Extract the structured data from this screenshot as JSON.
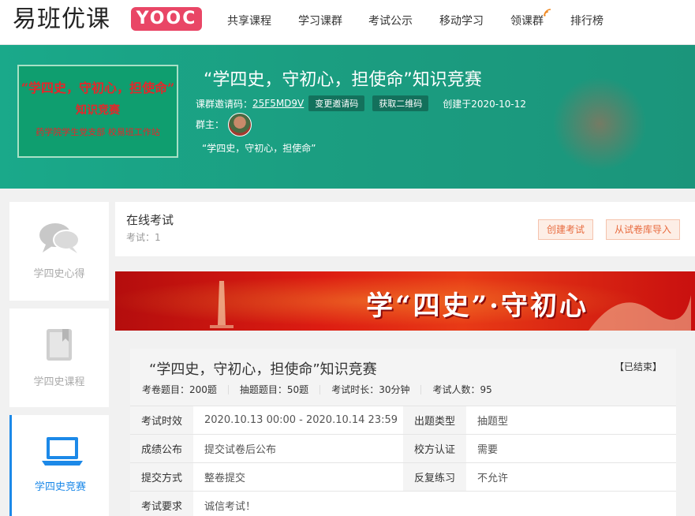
{
  "nav": {
    "logo_cn": "易班优课",
    "logo_en": "YOOC",
    "items": [
      "共享课程",
      "学习课群",
      "考试公示",
      "移动学习",
      "领课群",
      "排行榜"
    ]
  },
  "hero": {
    "cover": {
      "line1": "“学四史，守初心，担使命”",
      "line2": "知识竞赛",
      "line3": "药学院学生党支部  校易班工作站"
    },
    "title": "“学四史，守初心，担使命”知识竞赛",
    "invite_label": "课群邀请码：",
    "invite_code": "25F5MD9V",
    "change_code_btn": "变更邀请码",
    "qrcode_btn": "获取二维码",
    "created": "创建于2020-10-12",
    "owner_label": "群主：",
    "description": "“学四史，守初心，担使命”"
  },
  "sidebar": {
    "items": [
      {
        "label": "学四史心得",
        "icon": "chat-bubbles-icon"
      },
      {
        "label": "学四史课程",
        "icon": "book-icon"
      },
      {
        "label": "学四史竞赛",
        "icon": "laptop-icon"
      }
    ]
  },
  "main": {
    "title": "在线考试",
    "count": "考试：1",
    "create_btn": "创建考试",
    "import_btn": "从试卷库导入",
    "banner_text": "学“四史”·守初心"
  },
  "exam": {
    "title": "“学四史，守初心，担使命”知识竞赛",
    "status": "【已结束】",
    "stats": [
      "考卷题目：200题",
      "抽题题目：50题",
      "考试时长：30分钟",
      "考试人数：95"
    ],
    "rows": [
      {
        "k1": "考试时效",
        "v1": "2020.10.13 00:00 - 2020.10.14 23:59",
        "k2": "出题类型",
        "v2": "抽题型"
      },
      {
        "k1": "成绩公布",
        "v1": "提交试卷后公布",
        "k2": "校方认证",
        "v2": "需要"
      },
      {
        "k1": "提交方式",
        "v1": "整卷提交",
        "k2": "反复练习",
        "v2": "不允许"
      },
      {
        "k1": "考试要求",
        "v1": "诚信考试！",
        "k2": "",
        "v2": ""
      }
    ]
  },
  "colors": {
    "hero_green": "#1b9e81",
    "accent_blue": "#1c89e8",
    "logo_pink": "#e94666",
    "button_orange": "#e86b3f",
    "banner_red": "#d81c12"
  }
}
